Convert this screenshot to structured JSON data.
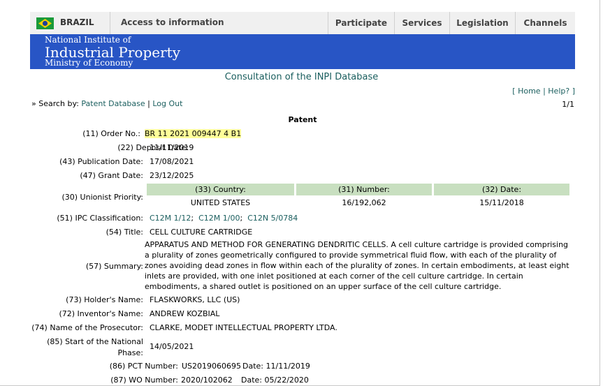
{
  "gov_bar": {
    "country": "BRAZIL",
    "access": "Access to information",
    "nav": [
      "Participate",
      "Services",
      "Legislation",
      "Channels"
    ]
  },
  "banner": {
    "line1": "National Institute of",
    "line2": "Industrial Property",
    "line3": "Ministry of Economy"
  },
  "consult_title": "Consultation of the INPI Database",
  "links": {
    "home": "Home",
    "help": "Help?",
    "search_by_label": "» Search by:",
    "patent_db": "Patent Database",
    "logout": "Log Out",
    "pager": "1/1"
  },
  "patent": {
    "section_title": "Patent",
    "order_label": "(11) Order No.:",
    "order_value": "BR 11 2021 009447 4 B1",
    "deposit_label": "(22)   Deposit Date:",
    "deposit_value": "11/11/2019",
    "publication_label": "(43)   Publication Date:",
    "publication_value": "17/08/2021",
    "grant_label": "(47)   Grant Date:",
    "grant_value": "23/12/2025",
    "priority_label": "(30)   Unionist Priority:",
    "priority_headers": [
      "(33)   Country:",
      "(31)   Number:",
      "(32)   Date:"
    ],
    "priority_values": [
      "UNITED STATES",
      "16/192,062",
      "15/11/2018"
    ],
    "ipc_label": "(51)   IPC Classification:",
    "ipc": [
      "C12M 1/12",
      "C12M 1/00",
      "C12N 5/0784"
    ],
    "ipc_sep": ";",
    "title_label": "(54)   Title:",
    "title_value": "CELL CULTURE CARTRIDGE",
    "summary_label": "(57)   Summary:",
    "summary_value": "APPARATUS AND METHOD FOR GENERATING DENDRITIC CELLS. A cell culture cartridge is provided comprising a plurality of zones geometrically configured to provide symmetrical fluid flow, with each of the plurality of zones avoiding dead zones in flow within each of the plurality of zones. In certain embodiments, at least eight inlets are provided, with one inlet positioned at each corner of the cell culture cartridge. In certain embodiments, a shared outlet is positioned on an upper surface of the cell culture cartridge.",
    "holder_label": "(73)   Holder's Name:",
    "holder_value": "FLASKWORKS, LLC (US)",
    "inventor_label": "(72)   Inventor's Name:",
    "inventor_value": "ANDREW KOZBIAL",
    "prosecutor_label": "(74)   Name of the Prosecutor:",
    "prosecutor_value": "CLARKE, MODET INTELLECTUAL PROPERTY LTDA.",
    "national_label_1": "(85)   Start of the National",
    "national_label_2": "Phase:",
    "national_value": "14/05/2021",
    "pct_label": "(86)   PCT  Number:",
    "pct_number": "US2019060695",
    "pct_date": "Date: 11/11/2019",
    "wo_label": "(87)   WO  Number:",
    "wo_number": "2020/102062",
    "wo_date": "Date: 05/22/2020"
  }
}
